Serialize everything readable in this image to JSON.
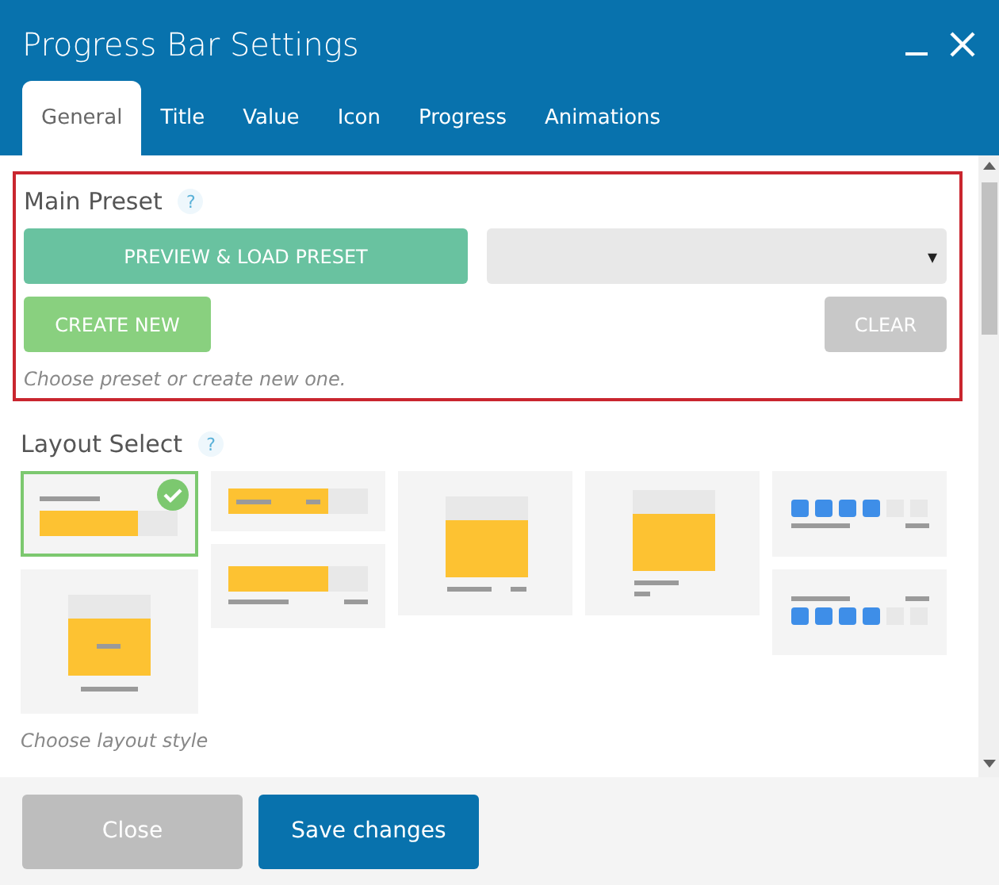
{
  "window": {
    "title": "Progress Bar Settings"
  },
  "tabs": [
    {
      "label": "General",
      "selected": true
    },
    {
      "label": "Title",
      "selected": false
    },
    {
      "label": "Value",
      "selected": false
    },
    {
      "label": "Icon",
      "selected": false
    },
    {
      "label": "Progress",
      "selected": false
    },
    {
      "label": "Animations",
      "selected": false
    }
  ],
  "main_preset": {
    "title": "Main Preset",
    "help": "?",
    "preview_button": "PREVIEW & LOAD PRESET",
    "dropdown_arrow": "▾",
    "create_button": "CREATE NEW",
    "clear_button": "CLEAR",
    "hint": "Choose preset or create new one."
  },
  "layout_select": {
    "title": "Layout Select",
    "help": "?",
    "hint": "Choose layout style",
    "columns": [
      {
        "items": [
          {
            "kind": "bar-label-top",
            "selected": true
          },
          {
            "kind": "box-centered",
            "selected": false
          }
        ]
      },
      {
        "items": [
          {
            "kind": "bar-inline",
            "selected": false
          },
          {
            "kind": "bar-label-bottom",
            "selected": false
          }
        ]
      },
      {
        "items": [
          {
            "kind": "box-label-bottom",
            "selected": false
          }
        ]
      },
      {
        "items": [
          {
            "kind": "box-label-below",
            "selected": false
          }
        ]
      },
      {
        "items": [
          {
            "kind": "blocks-label-bottom",
            "selected": false
          },
          {
            "kind": "blocks-label-top",
            "selected": false
          }
        ]
      }
    ]
  },
  "buttons": [
    {
      "label": "Close",
      "kind": "secondary"
    },
    {
      "label": "Save changes",
      "kind": "primary"
    }
  ]
}
